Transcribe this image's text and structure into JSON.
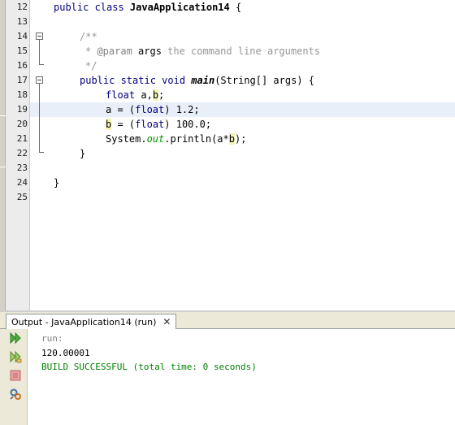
{
  "editor": {
    "line_numbers": [
      "12",
      "13",
      "14",
      "15",
      "16",
      "17",
      "18",
      "19",
      "20",
      "21",
      "22",
      "23",
      "24",
      "25"
    ],
    "lines": {
      "l12_kw": "public class ",
      "l12_name": "JavaApplication14",
      "l12_rest": " {",
      "l14": "/**",
      "l15_star": "* ",
      "l15_tag": "@param",
      "l15_arg": " args",
      "l15_text": " the command line arguments",
      "l16": "*/",
      "l17_kw": "public static void ",
      "l17_fn": "main",
      "l17_rest": "(String[] args) {",
      "l18_kw": "float ",
      "l18_a": "a,",
      "l18_b": "b",
      "l18_end": ";",
      "l19_a": "a = (",
      "l19_kw": "float",
      "l19_rest": ") 1.2;",
      "l20_b": "b",
      "l20_mid": " = (",
      "l20_kw": "float",
      "l20_rest": ") 100.0;",
      "l21_sys": "System.",
      "l21_out": "out",
      "l21_mid": ".println(a*",
      "l21_b": "b",
      "l21_end": ");",
      "l22": "}",
      "l24": "}"
    }
  },
  "output": {
    "tab_label": "Output - JavaApplication14 (run)",
    "close_glyph": "✕",
    "lines": [
      "run:",
      "120.00001",
      "BUILD SUCCESSFUL (total time: 0 seconds)"
    ],
    "colors": {
      "run": "#808080",
      "value": "#000000",
      "success": "#008000"
    }
  },
  "icons": [
    "rerun-icon",
    "rerun-with-options-icon",
    "stop-icon",
    "settings-icon"
  ]
}
